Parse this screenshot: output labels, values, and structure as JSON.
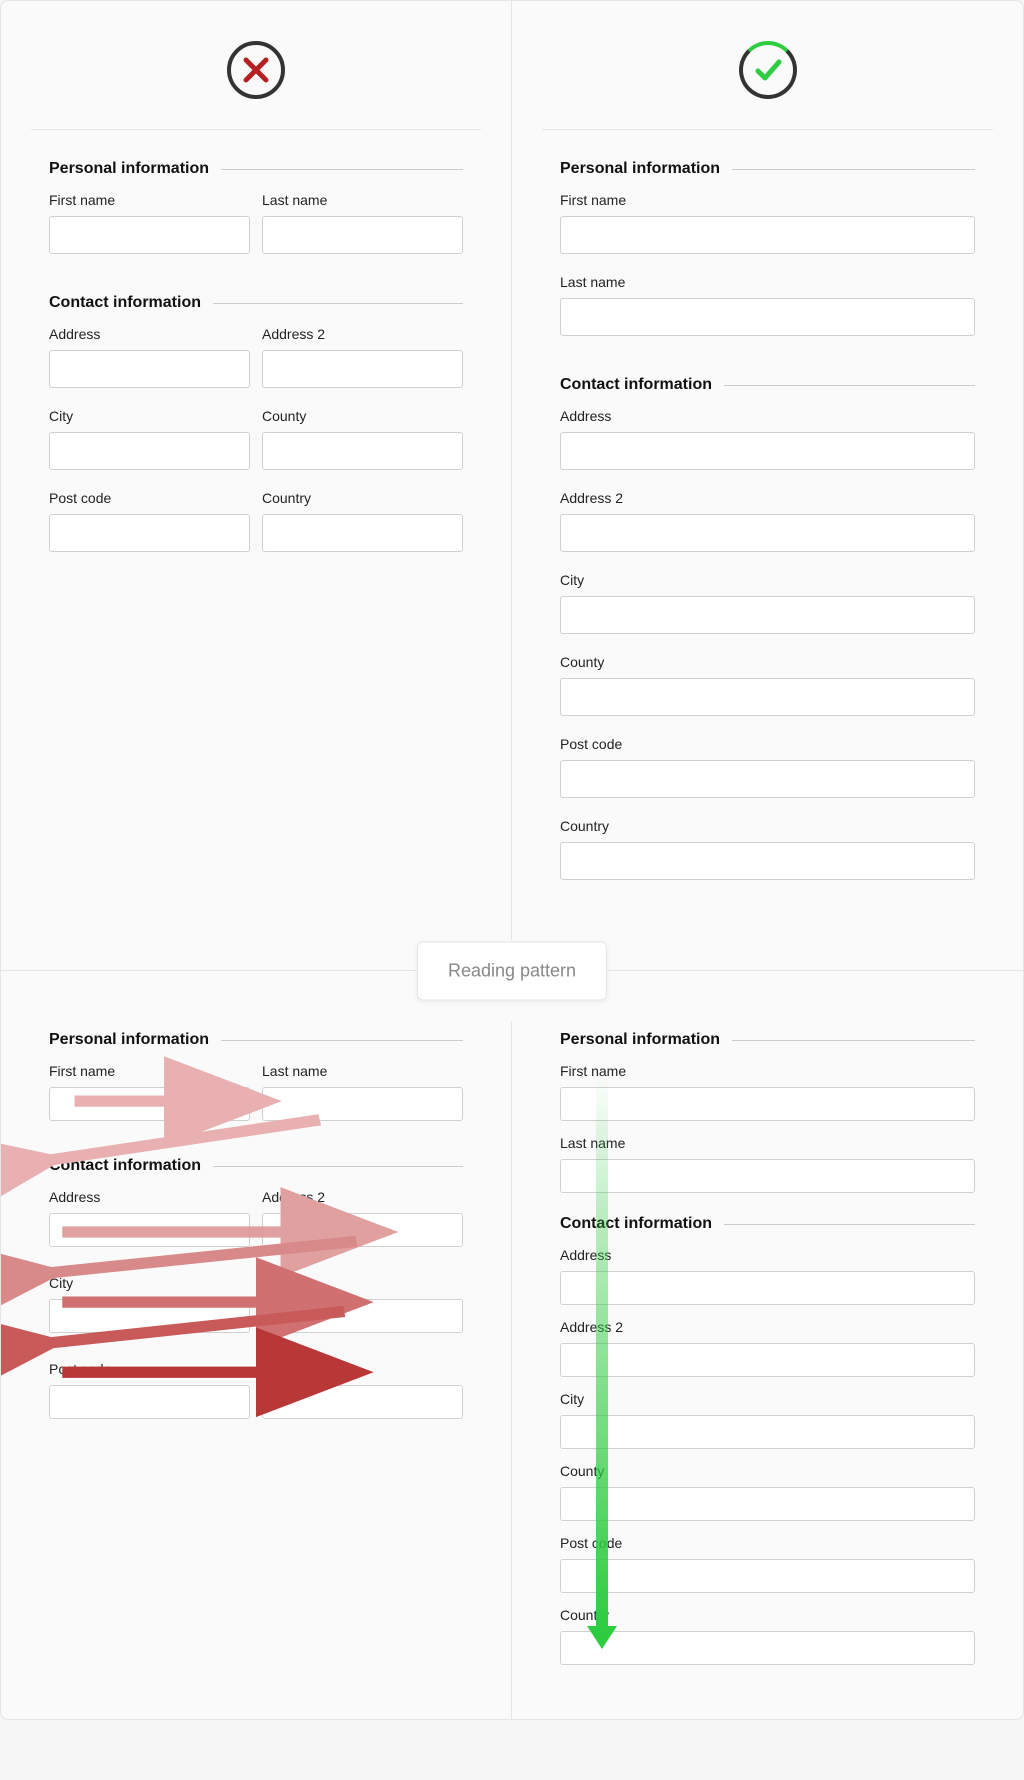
{
  "labels": {
    "personal": "Personal information",
    "contact": "Contact information",
    "first_name": "First name",
    "last_name": "Last name",
    "address": "Address",
    "address2": "Address 2",
    "city": "City",
    "county": "County",
    "post_code": "Post code",
    "country": "Country"
  },
  "divider": {
    "label": "Reading pattern"
  },
  "icons": {
    "bad": "cross",
    "good": "check"
  },
  "colors": {
    "bad": "#b52023",
    "good": "#2ecc40",
    "arrow_base": "#c84a4a"
  }
}
